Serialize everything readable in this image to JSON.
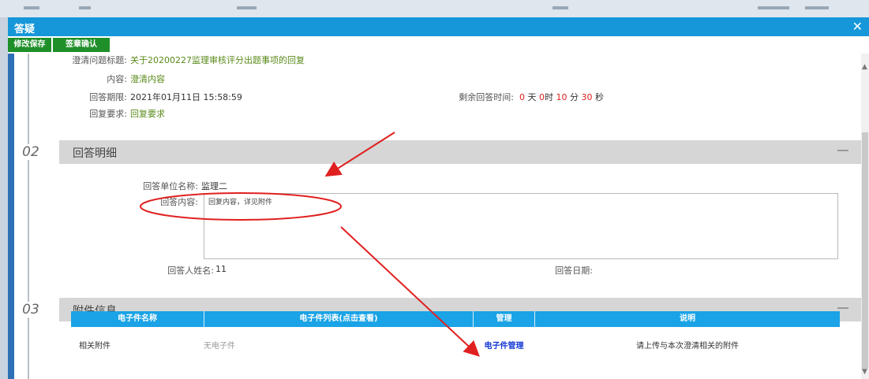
{
  "dialog": {
    "title": "答疑",
    "close_glyph": "✕"
  },
  "toolbar": {
    "save_label": "修改保存",
    "confirm_label": "签章确认"
  },
  "question": {
    "subject_label": "澄清问题标题:",
    "subject_value": "关于20200227监理审核评分出题事项的回复",
    "content_label": "内容:",
    "content_value": "澄清内容",
    "deadline_label": "回答期限:",
    "deadline_value": "2021年01月11日 15:58:59",
    "remaining_label": "剩余回答时间:",
    "remaining": {
      "days": "0",
      "days_unit": "天",
      "hours": "0",
      "hours_unit": "时",
      "minutes": "10",
      "minutes_unit": "分",
      "seconds": "30",
      "seconds_unit": "秒"
    },
    "requirement_label": "回复要求:",
    "requirement_value": "回复要求"
  },
  "section2": {
    "number": "02",
    "title": "回答明细",
    "unit_label": "回答单位名称:",
    "unit_value": "监理二",
    "answer_label": "回答内容:",
    "answer_value": "回复内容，详见附件",
    "person_label": "回答人姓名:",
    "person_value": "11",
    "date_label": "回答日期:",
    "date_value": ""
  },
  "section3": {
    "number": "03",
    "title": "附件信息",
    "columns": [
      "电子件名称",
      "电子件列表(点击查看)",
      "管理",
      "说明"
    ],
    "row": {
      "name": "相关附件",
      "files": "无电子件",
      "manage": "电子件管理",
      "note": "请上传与本次澄清相关的附件"
    }
  },
  "colors": {
    "titlebar": "#1697d9",
    "toolbar_button": "#1f8f2a",
    "table_header": "#1aa3e6",
    "annotation": "#e02020",
    "link": "#1439d6"
  },
  "icons": {
    "close": "close-icon",
    "collapse": "collapse-icon",
    "scroll_up": "scroll-up-icon",
    "scroll_down": "scroll-down-icon"
  }
}
